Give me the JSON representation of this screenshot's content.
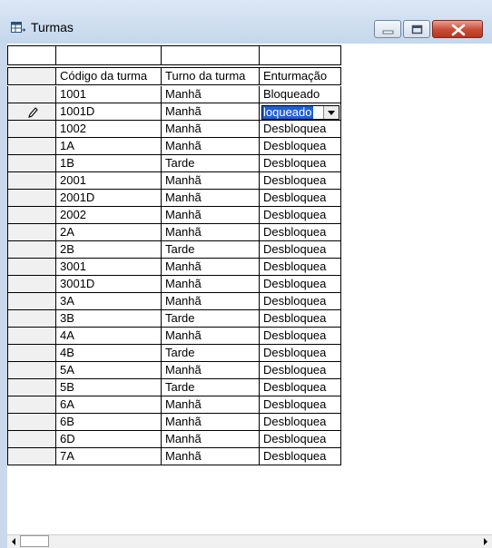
{
  "window": {
    "title": "Turmas",
    "icon": "table-form-icon",
    "colors": {
      "title_bar": "#c5d7ec",
      "close_button": "#c94a33",
      "selection": "#1f5fd6"
    }
  },
  "grid": {
    "columns": [
      "Código da turma",
      "Turno da turma",
      "Enturmação"
    ],
    "filter_values": [
      "",
      "",
      ""
    ],
    "editing_row": 1,
    "editor": {
      "text": "loqueado",
      "dropdown_icon": "chevron-down-icon"
    },
    "rows": [
      [
        "1001",
        "Manhã",
        "Bloqueado"
      ],
      [
        "1001D",
        "Manhã",
        ""
      ],
      [
        "1002",
        "Manhã",
        "Desbloquea"
      ],
      [
        "1A",
        "Manhã",
        "Desbloquea"
      ],
      [
        "1B",
        "Tarde",
        "Desbloquea"
      ],
      [
        "2001",
        "Manhã",
        "Desbloquea"
      ],
      [
        "2001D",
        "Manhã",
        "Desbloquea"
      ],
      [
        "2002",
        "Manhã",
        "Desbloquea"
      ],
      [
        "2A",
        "Manhã",
        "Desbloquea"
      ],
      [
        "2B",
        "Tarde",
        "Desbloquea"
      ],
      [
        "3001",
        "Manhã",
        "Desbloquea"
      ],
      [
        "3001D",
        "Manhã",
        "Desbloquea"
      ],
      [
        "3A",
        "Manhã",
        "Desbloquea"
      ],
      [
        "3B",
        "Tarde",
        "Desbloquea"
      ],
      [
        "4A",
        "Manhã",
        "Desbloquea"
      ],
      [
        "4B",
        "Tarde",
        "Desbloquea"
      ],
      [
        "5A",
        "Manhã",
        "Desbloquea"
      ],
      [
        "5B",
        "Tarde",
        "Desbloquea"
      ],
      [
        "6A",
        "Manhã",
        "Desbloquea"
      ],
      [
        "6B",
        "Manhã",
        "Desbloquea"
      ],
      [
        "6D",
        "Manhã",
        "Desbloquea"
      ],
      [
        "7A",
        "Manhã",
        "Desbloquea"
      ]
    ]
  }
}
